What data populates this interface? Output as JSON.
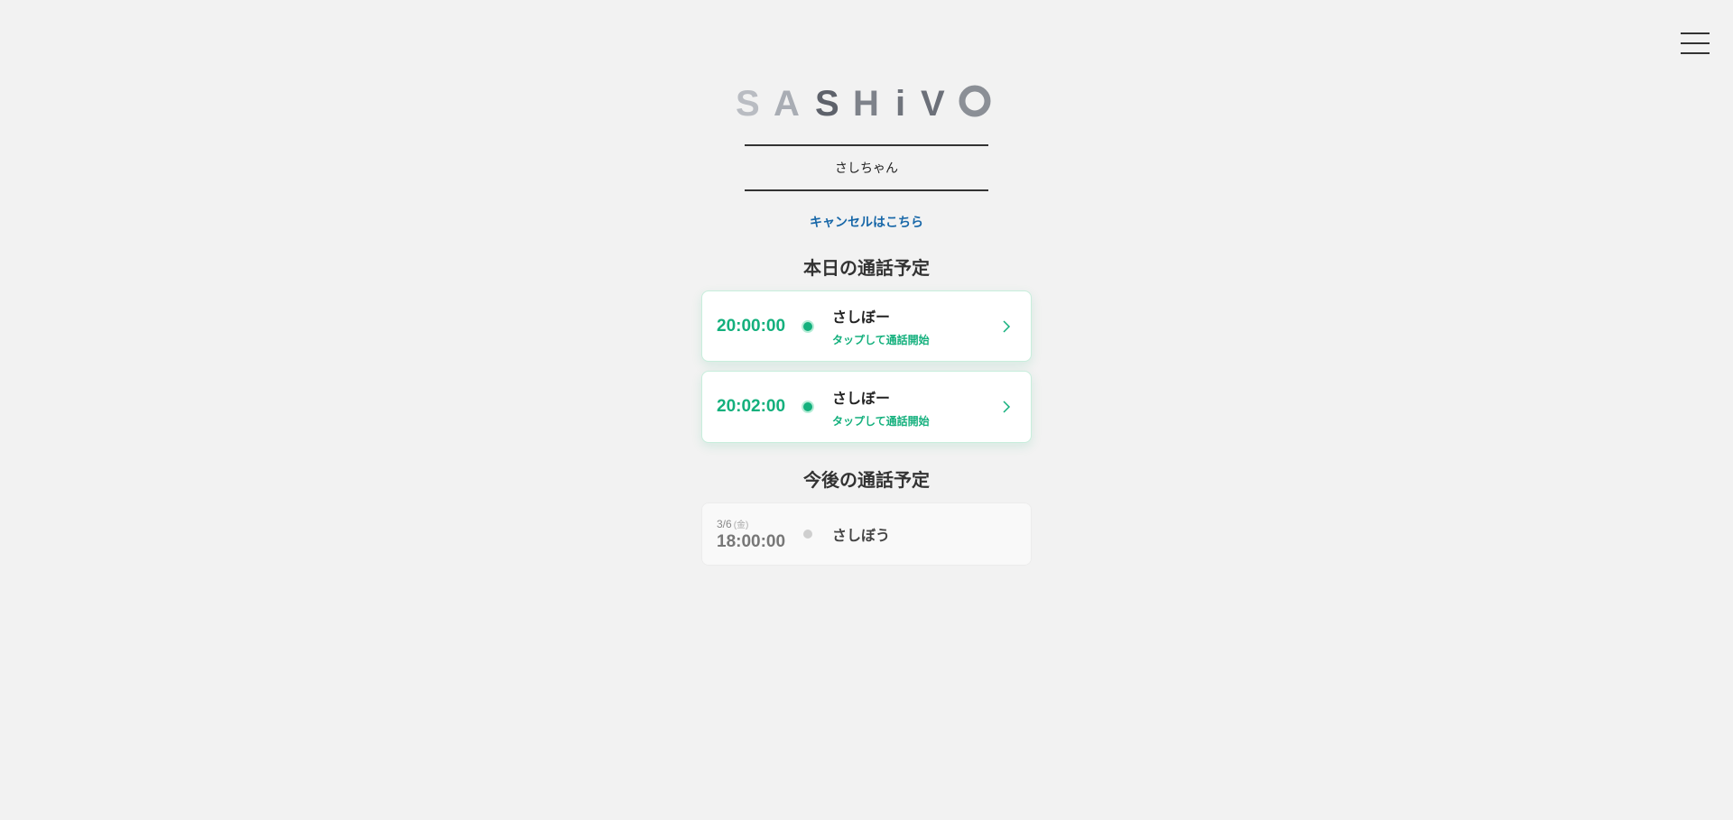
{
  "header": {
    "brand": "SASHIVO",
    "menu_icon": "hamburger-icon"
  },
  "user": {
    "name": "さしちゃん"
  },
  "cancel_link": "キャンセルはこちら",
  "today": {
    "title": "本日の通話予定",
    "items": [
      {
        "time": "20:00:00",
        "name": "さしぼー",
        "action": "タップして通話開始"
      },
      {
        "time": "20:02:00",
        "name": "さしぼー",
        "action": "タップして通話開始"
      }
    ]
  },
  "upcoming": {
    "title": "今後の通話予定",
    "items": [
      {
        "date": "3/6",
        "weekday": "(金)",
        "time": "18:00:00",
        "name": "さしぼう"
      }
    ]
  },
  "colors": {
    "accent_green": "#14b07d",
    "link_blue": "#1767a8",
    "background": "#f2f2f2"
  }
}
